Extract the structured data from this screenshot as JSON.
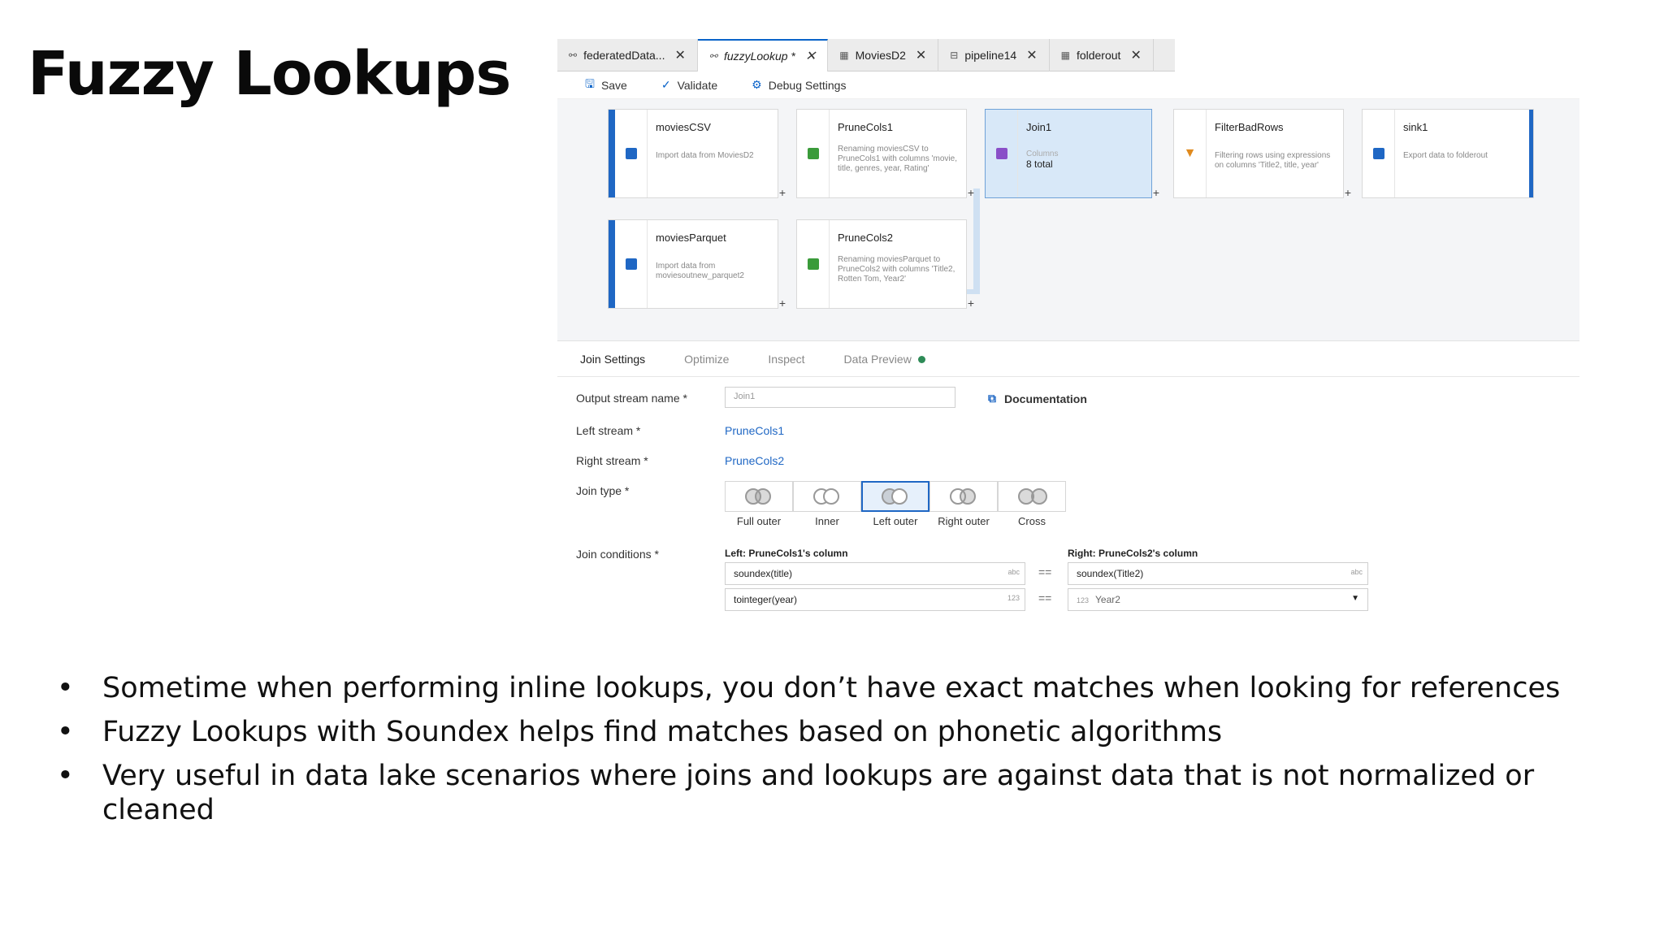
{
  "slide": {
    "title": "Fuzzy Lookups",
    "bullets": [
      "Sometime when performing inline lookups, you don’t have exact matches when looking for references",
      "Fuzzy Lookups with Soundex helps find matches based on phonetic algorithms",
      "Very useful in data lake scenarios where joins and lookups are against data that is not normalized or cleaned"
    ]
  },
  "tabs": [
    {
      "label": "federatedData...",
      "icon": "dataflow-icon"
    },
    {
      "label": "fuzzyLookup *",
      "icon": "dataflow-icon"
    },
    {
      "label": "MoviesD2",
      "icon": "table-icon"
    },
    {
      "label": "pipeline14",
      "icon": "pipeline-icon"
    },
    {
      "label": "folderout",
      "icon": "table-icon"
    }
  ],
  "toolbar": {
    "save_label": "Save",
    "validate_label": "Validate",
    "debug_label": "Debug Settings"
  },
  "nodes": {
    "moviesCSV": {
      "name": "moviesCSV",
      "desc": "Import data from MoviesD2"
    },
    "pruneCols1": {
      "name": "PruneCols1",
      "desc": "Renaming moviesCSV to PruneCols1 with columns 'movie, title, genres, year, Rating'"
    },
    "join1": {
      "name": "Join1",
      "meta": "Columns",
      "total": "8 total"
    },
    "filterBadRows": {
      "name": "FilterBadRows",
      "desc": "Filtering rows using expressions on columns 'Title2, title, year'"
    },
    "sink1": {
      "name": "sink1",
      "desc": "Export data to folderout"
    },
    "moviesParquet": {
      "name": "moviesParquet",
      "desc": "Import data from moviesoutnew_parquet2"
    },
    "pruneCols2": {
      "name": "PruneCols2",
      "desc": "Renaming moviesParquet to PruneCols2 with columns 'Title2, Rotten Tom, Year2'"
    }
  },
  "subtabs": {
    "join_settings": "Join Settings",
    "optimize": "Optimize",
    "inspect": "Inspect",
    "data_preview": "Data Preview"
  },
  "form": {
    "output_stream_label": "Output stream name *",
    "output_stream_value": "Join1",
    "documentation_label": "Documentation",
    "left_stream_label": "Left stream *",
    "left_stream_value": "PruneCols1",
    "right_stream_label": "Right stream *",
    "right_stream_value": "PruneCols2",
    "join_type_label": "Join type *",
    "join_types": [
      "Full outer",
      "Inner",
      "Left outer",
      "Right outer",
      "Cross"
    ],
    "join_type_selected": "Left outer",
    "join_conditions_label": "Join conditions *",
    "left_column_header": "Left: PruneCols1's column",
    "right_column_header": "Right: PruneCols2's column",
    "conditions": [
      {
        "left": "soundex(title)",
        "left_type": "abc",
        "op": "==",
        "right": "soundex(Title2)",
        "right_type": "abc"
      },
      {
        "left": "tointeger(year)",
        "left_type": "123",
        "op": "==",
        "right": "Year2",
        "right_type": "123"
      }
    ]
  },
  "colors": {
    "accent": "#1f67c4",
    "selected_node": "#d8e8f8",
    "preview_dot": "#2e8b57"
  }
}
